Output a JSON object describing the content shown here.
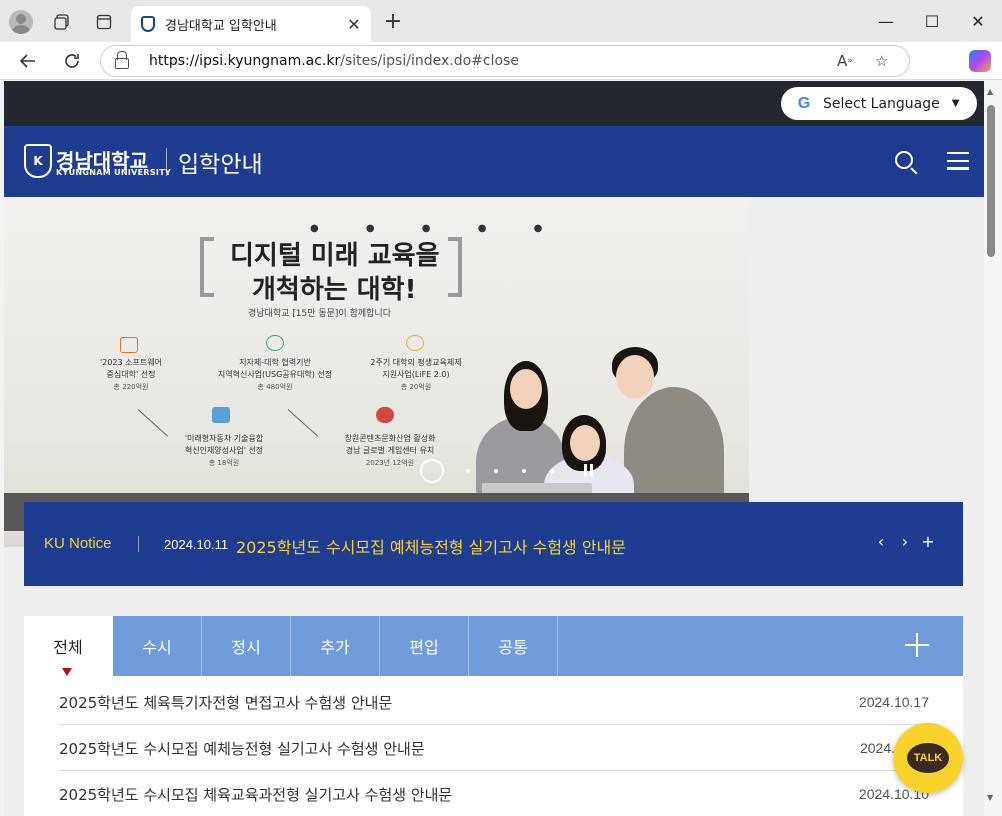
{
  "browser": {
    "tab_title": "경남대학교 입학안내",
    "url_host": "https://ipsi.kyungnam.ac.kr",
    "url_path": "/sites/ipsi/index.do#close",
    "win_min": "—",
    "win_max": "☐",
    "win_close": "✕",
    "tab_close": "✕",
    "new_tab": "+"
  },
  "page": {
    "select_language": "Select Language",
    "logo_kr": "경남대학교",
    "logo_en": "KYUNGNAM UNIVERSITY",
    "site_title": "입학안내",
    "banner": {
      "headline1": "디지털 미래 교육을",
      "headline2": "개척하는 대학!",
      "subline": "경남대학교 [15만 동문]이 함께합니다",
      "items": [
        {
          "l1": "'2023 소프트웨어",
          "l2": "중심대학' 선정",
          "amt": "총 220억원"
        },
        {
          "l1": "지자체-대학 협력기반",
          "l2": "지역혁신사업(USG공유대학) 선정",
          "amt": "총 480억원"
        },
        {
          "l1": "2주기 대학의 평생교육체제",
          "l2": "지원사업(LiFE 2.0)",
          "amt": "총 20억원"
        },
        {
          "l1": "'미래형자동차 기술융합",
          "l2": "혁신인재양성사업' 선정",
          "amt": "총 18억원"
        },
        {
          "l1": "창원콘텐츠문화산업 활성화",
          "l2": "경남 글로벌 게임센터 유치",
          "amt": "2023년 12억원"
        }
      ]
    },
    "notice": {
      "label": "KU Notice",
      "date": "2024.10.11",
      "title": "2025학년도 수시모집 예체능전형 실기고사 수험생 안내문",
      "prev": "‹",
      "next": "›",
      "more": "+"
    },
    "tabs": [
      "전체",
      "수시",
      "정시",
      "추가",
      "편입",
      "공통"
    ],
    "rows": [
      {
        "title": "2025학년도 체육특기자전형 면접고사 수험생 안내문",
        "date": "2024.10.17"
      },
      {
        "title": "2025학년도 수시모집 예체능전형 실기고사 수험생 안내문",
        "date": "2024.10.11"
      },
      {
        "title": "2025학년도 수시모집 체육교육과전형 실기고사 수험생 안내문",
        "date": "2024.10.10"
      }
    ],
    "talk": "TALK"
  }
}
